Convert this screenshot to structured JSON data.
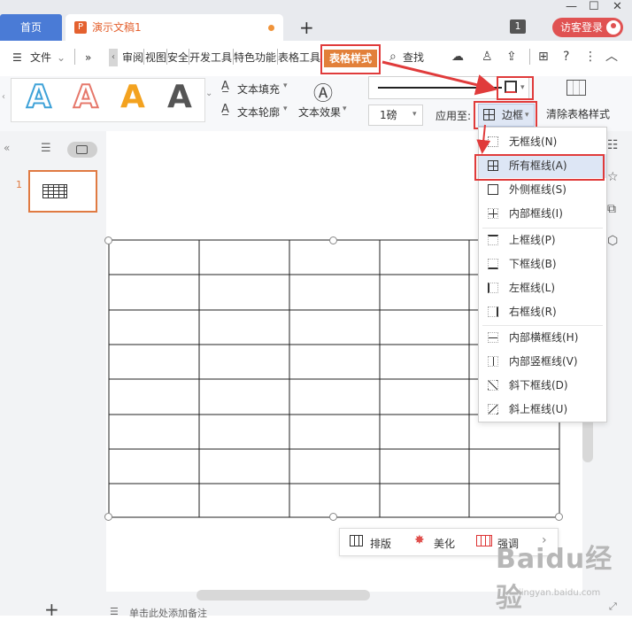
{
  "titlebar": {
    "home_tab": "首页",
    "doc_tab": "演示文稿1",
    "doc_icon_glyph": "P",
    "new_tab": "+",
    "window_badge": "1",
    "login": "访客登录"
  },
  "ribbon": {
    "file_menu": "文件",
    "more": "»",
    "tabs": [
      "审阅",
      "视图",
      "安全",
      "开发工具",
      "特色功能",
      "表格工具",
      "表格样式"
    ],
    "search": "查找"
  },
  "panel": {
    "text_fill": "文本填充",
    "text_outline": "文本轮廓",
    "text_effect": "文本效果",
    "line_weight": "1磅",
    "apply_to": "应用至:",
    "border_btn": "边框",
    "clear_style": "清除表格样式"
  },
  "slides": {
    "thumb_number": "1"
  },
  "border_menu": {
    "items": [
      "无框线(N)",
      "所有框线(A)",
      "外侧框线(S)",
      "内部框线(I)",
      "上框线(P)",
      "下框线(B)",
      "左框线(L)",
      "右框线(R)",
      "内部横框线(H)",
      "内部竖框线(V)",
      "斜下框线(D)",
      "斜上框线(U)"
    ]
  },
  "float_toolbar": {
    "layout": "排版",
    "beautify": "美化",
    "emphasize": "强调"
  },
  "notes": {
    "placeholder": "单击此处添加备注"
  },
  "watermark": {
    "logo": "Baidu经验",
    "url": "jingyan.baidu.com"
  },
  "colors": {
    "accent_red": "#e03b3b",
    "accent_orange": "#e2803a",
    "home_blue": "#4a7bd6"
  }
}
